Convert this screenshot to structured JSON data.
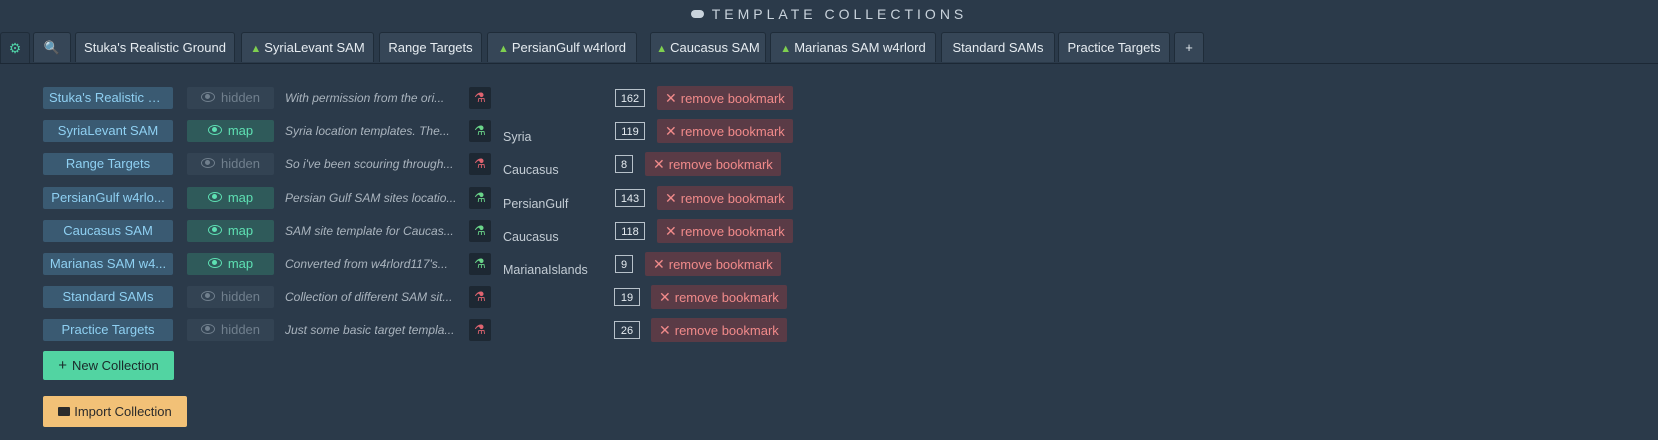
{
  "header": {
    "title": "TEMPLATE COLLECTIONS"
  },
  "tabs": [
    {
      "label": "",
      "icon": "gear-icon"
    },
    {
      "label": "",
      "icon": "search-icon"
    },
    {
      "label": "Stuka's Realistic Ground",
      "icon": ""
    },
    {
      "label": "SyriaLevant SAM",
      "icon": "tree-icon"
    },
    {
      "label": "Range Targets",
      "icon": ""
    },
    {
      "label": "PersianGulf w4rlord",
      "icon": "tree-icon"
    },
    {
      "label": "Caucasus SAM",
      "icon": "tree-icon"
    },
    {
      "label": "Marianas SAM w4rlord",
      "icon": "tree-icon"
    },
    {
      "label": "Standard SAMs",
      "icon": ""
    },
    {
      "label": "Practice Targets",
      "icon": ""
    },
    {
      "label": "+",
      "icon": "plus-icon"
    }
  ],
  "collections": [
    {
      "name": "Stuka's Realistic G...",
      "visibility": "hidden",
      "description": "With permission from the ori...",
      "status": "bad",
      "terrain": "",
      "count": "162",
      "remove_label": "remove bookmark"
    },
    {
      "name": "SyriaLevant SAM",
      "visibility": "map",
      "description": "Syria location templates. The...",
      "status": "ok",
      "terrain": "Syria",
      "count": "119",
      "remove_label": "remove bookmark"
    },
    {
      "name": "Range Targets",
      "visibility": "hidden",
      "description": "So i've been scouring through...",
      "status": "bad",
      "terrain": "Caucasus",
      "count": "8",
      "remove_label": "remove bookmark"
    },
    {
      "name": "PersianGulf w4rlo...",
      "visibility": "map",
      "description": "Persian Gulf SAM sites locatio...",
      "status": "ok",
      "terrain": "PersianGulf",
      "count": "143",
      "remove_label": "remove bookmark"
    },
    {
      "name": "Caucasus SAM",
      "visibility": "map",
      "description": "SAM site template for Caucas...",
      "status": "ok",
      "terrain": "Caucasus",
      "count": "118",
      "remove_label": "remove bookmark"
    },
    {
      "name": "Marianas SAM w4...",
      "visibility": "map",
      "description": "Converted from w4rlord117's...",
      "status": "ok",
      "terrain": "MarianaIslands",
      "count": "9",
      "remove_label": "remove bookmark"
    },
    {
      "name": "Standard SAMs",
      "visibility": "hidden",
      "description": "Collection of different SAM sit...",
      "status": "bad",
      "terrain": "",
      "count": "19",
      "remove_label": "remove bookmark"
    },
    {
      "name": "Practice Targets",
      "visibility": "hidden",
      "description": "Just some basic target templa...",
      "status": "bad",
      "terrain": "",
      "count": "26",
      "remove_label": "remove bookmark"
    }
  ],
  "actions": {
    "new_collection": "New Collection",
    "import_collection": "Import Collection"
  },
  "colors": {
    "accent_green": "#52d4a2",
    "accent_orange": "#f2c177",
    "danger": "#f18a8a",
    "background": "#2b3a4a"
  }
}
